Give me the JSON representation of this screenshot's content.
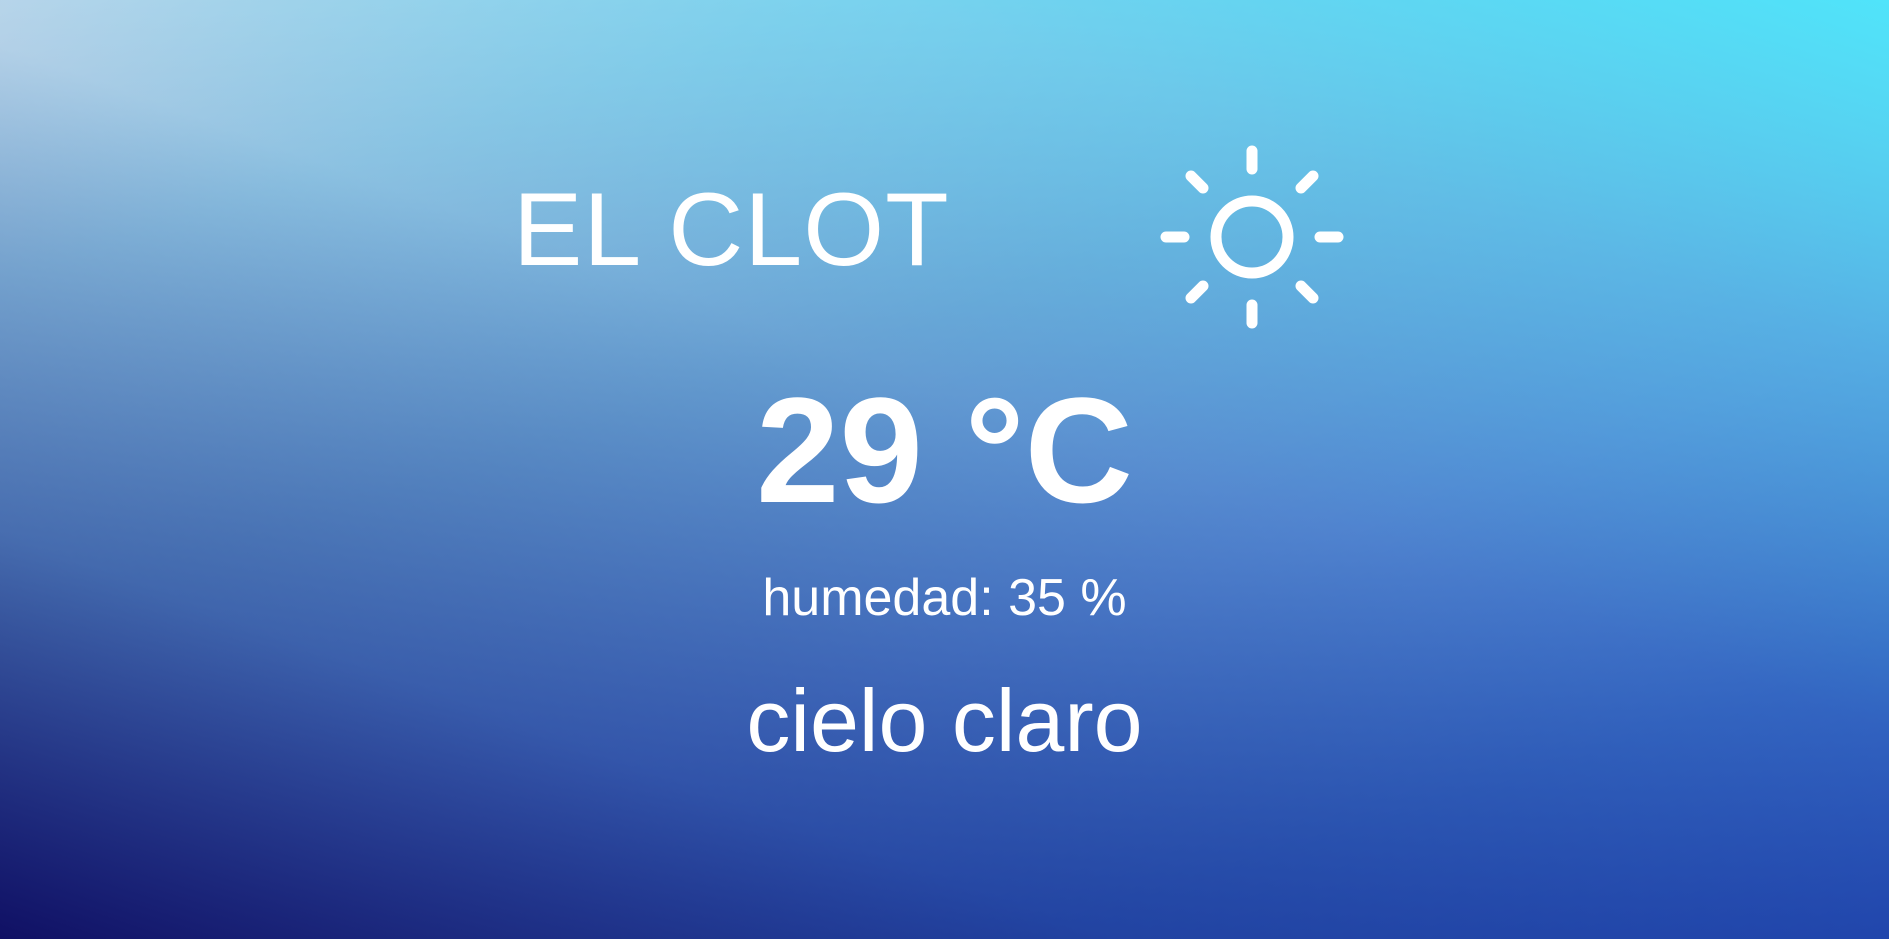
{
  "weather": {
    "city": "EL CLOT",
    "icon": "sun-icon",
    "temperature": "29 °C",
    "humidity": "humedad: 35 %",
    "description": "cielo claro"
  },
  "colors": {
    "text": "#ffffff",
    "gradient_top_left": "#ffffff",
    "gradient_top_right": "#50e4fa",
    "gradient_bottom_left": "#1a4fd6",
    "gradient_bottom_right": "#101064"
  }
}
